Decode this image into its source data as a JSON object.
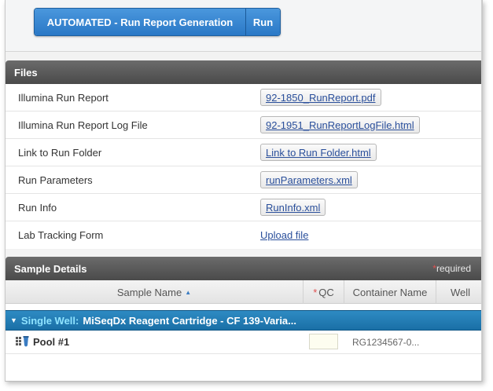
{
  "actions": {
    "main_label": "AUTOMATED - Run Report Generation",
    "run_label": "Run"
  },
  "files": {
    "header": "Files",
    "rows": [
      {
        "label": "Illumina Run Report",
        "link": "92-1850_RunReport.pdf"
      },
      {
        "label": "Illumina Run Report Log File",
        "link": "92-1951_RunReportLogFile.html"
      },
      {
        "label": "Link to Run Folder",
        "link": "Link to Run Folder.html"
      },
      {
        "label": "Run Parameters",
        "link": "runParameters.xml"
      },
      {
        "label": "Run Info",
        "link": "RunInfo.xml"
      },
      {
        "label": "Lab Tracking Form",
        "link": "Upload file"
      }
    ]
  },
  "sample_details": {
    "header": "Sample Details",
    "required_star": "*",
    "required_text": "required",
    "columns": {
      "sample_name": "Sample Name",
      "qc_star": "*",
      "qc": "QC",
      "container_name": "Container Name",
      "well": "Well"
    },
    "group": {
      "prefix": "Single Well:",
      "name": "MiSeqDx Reagent Cartridge - CF 139-Varia..."
    },
    "pool": {
      "name": "Pool #1",
      "container": "RG1234567-0..."
    }
  },
  "colors": {
    "button_blue": "#2a78c6",
    "header_gray": "#4a4a4a",
    "group_blue": "#1a6fa6",
    "link_blue": "#2a4f9b",
    "required_red": "#e05050"
  }
}
